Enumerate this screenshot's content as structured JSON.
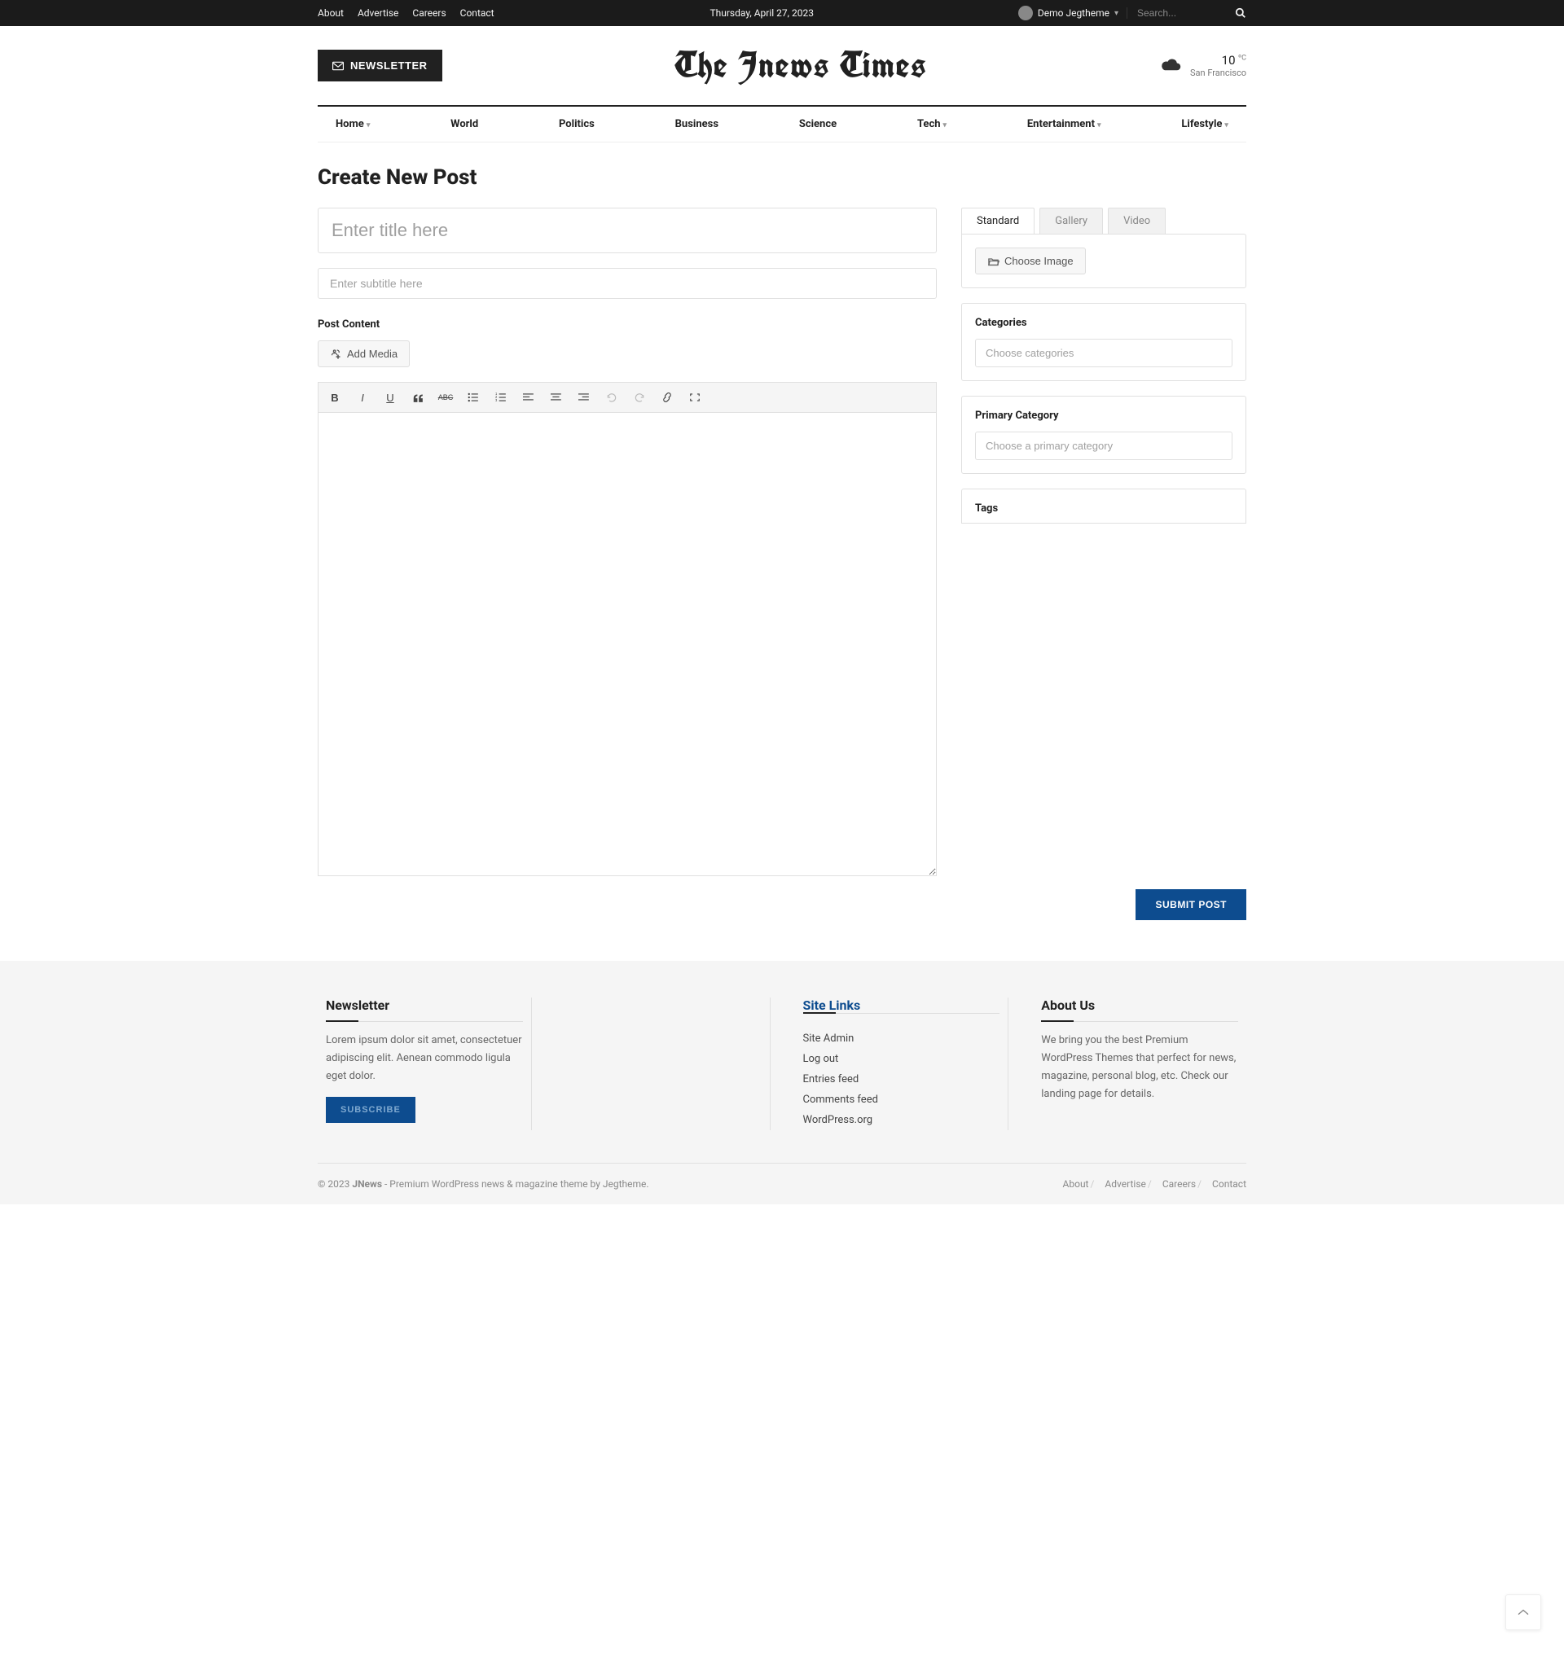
{
  "topbar": {
    "links": [
      "About",
      "Advertise",
      "Careers",
      "Contact"
    ],
    "date": "Thursday, April 27, 2023",
    "user": "Demo Jegtheme",
    "search_placeholder": "Search..."
  },
  "header": {
    "newsletter": "NEWSLETTER",
    "logo": "The Jnews Times",
    "weather": {
      "temp": "10",
      "unit": "ºC",
      "location": "San Francisco"
    }
  },
  "nav": {
    "items": [
      {
        "label": "Home",
        "dropdown": true
      },
      {
        "label": "World",
        "dropdown": false
      },
      {
        "label": "Politics",
        "dropdown": false
      },
      {
        "label": "Business",
        "dropdown": false
      },
      {
        "label": "Science",
        "dropdown": false
      },
      {
        "label": "Tech",
        "dropdown": true
      },
      {
        "label": "Entertainment",
        "dropdown": true
      },
      {
        "label": "Lifestyle",
        "dropdown": true
      }
    ]
  },
  "page": {
    "title": "Create New Post",
    "title_placeholder": "Enter title here",
    "subtitle_placeholder": "Enter subtitle here",
    "content_label": "Post Content",
    "add_media": "Add Media",
    "submit": "SUBMIT POST"
  },
  "side": {
    "tabs": [
      "Standard",
      "Gallery",
      "Video"
    ],
    "choose_image": "Choose Image",
    "categories": {
      "title": "Categories",
      "placeholder": "Choose categories"
    },
    "primary": {
      "title": "Primary Category",
      "placeholder": "Choose a primary category"
    },
    "tags": {
      "title": "Tags"
    }
  },
  "footer": {
    "newsletter": {
      "title": "Newsletter",
      "text": "Lorem ipsum dolor sit amet, consectetuer adipiscing elit. Aenean commodo ligula eget dolor.",
      "button": "SUBSCRIBE"
    },
    "sitelinks": {
      "title": "Site Links",
      "items": [
        "Site Admin",
        "Log out",
        "Entries feed",
        "Comments feed",
        "WordPress.org"
      ]
    },
    "about": {
      "title": "About Us",
      "text": "We bring you the best Premium WordPress Themes that perfect for news, magazine, personal blog, etc. Check our landing page for details."
    },
    "bottom": {
      "copyright_prefix": "© 2023 ",
      "brand": "JNews",
      "copyright_mid": " - Premium WordPress news & magazine theme by ",
      "brand2": "Jegtheme",
      "suffix": ".",
      "links": [
        "About",
        "Advertise",
        "Careers",
        "Contact"
      ]
    }
  }
}
